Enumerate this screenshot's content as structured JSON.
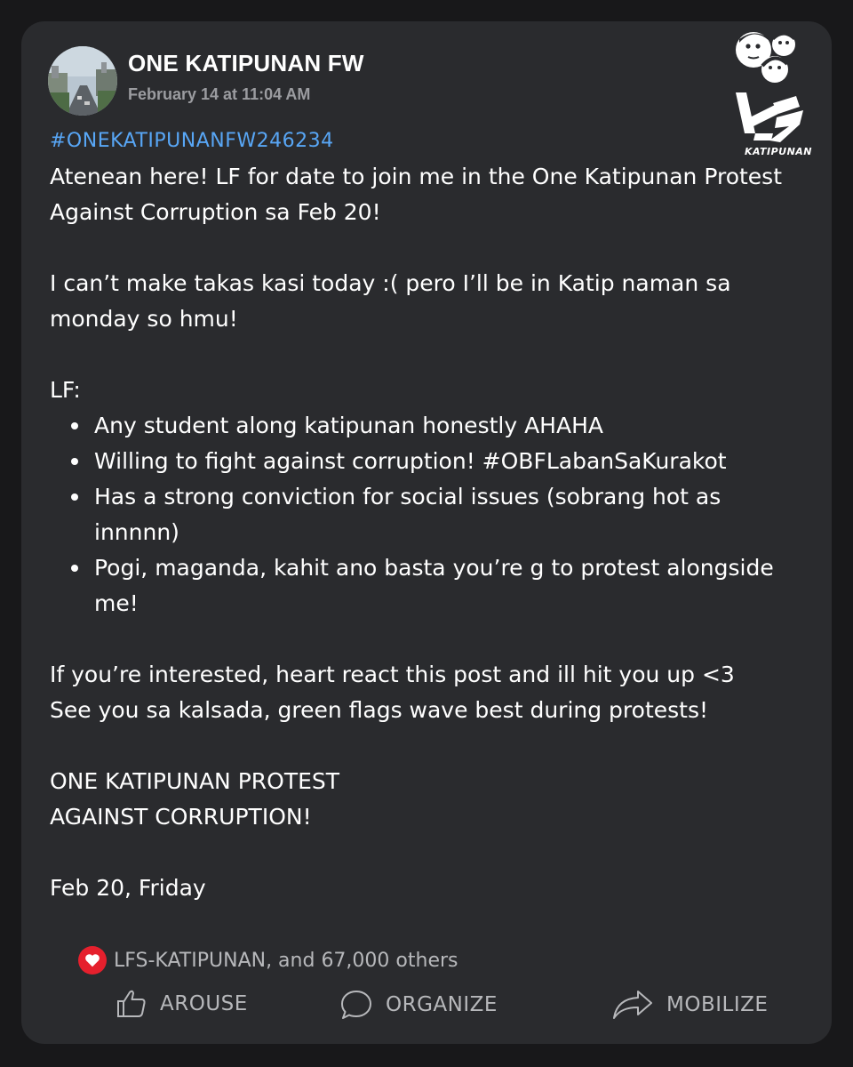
{
  "post": {
    "page_name": "ONE KATIPUNAN FW",
    "timestamp": "February 14 at 11:04 AM",
    "hashtag": "#ONEKATIPUNANFW246234",
    "paragraph1": "Atenean here! LF for date to join me in the One Katipunan Protest Against Corruption sa Feb 20!",
    "paragraph2": "I can’t make takas kasi today :( pero I’ll be in Katip naman sa monday so hmu!",
    "lf_heading": "LF:",
    "lf_items": [
      "Any student along katipunan honestly AHAHA",
      "Willing to fight against corruption! #OBFLabanSaKurakot",
      "Has a strong conviction for social issues (sobrang hot as innnnn)",
      "Pogi, maganda, kahit ano basta you’re g to protest alongside me!"
    ],
    "paragraph3_line1": "If you’re interested, heart react this post and ill hit you up <3",
    "paragraph3_line2": "See you sa kalsada, green flags wave best during protests!",
    "paragraph4_line1": "ONE KATIPUNAN PROTEST",
    "paragraph4_line2": "AGAINST CORRUPTION!",
    "paragraph5": "Feb 20, Friday"
  },
  "logo": {
    "text": "KATIPUNAN",
    "icon": "lfs-katipunan-logo"
  },
  "reactions": {
    "icon": "heart-icon",
    "text": "LFS-KATIPUNAN, and 67,000 others",
    "color": "#e5202d"
  },
  "actions": {
    "arouse": {
      "label": "AROUSE",
      "icon": "thumbs-up-icon"
    },
    "organize": {
      "label": "ORGANIZE",
      "icon": "comment-bubble-icon"
    },
    "mobilize": {
      "label": "MOBILIZE",
      "icon": "share-arrow-icon"
    }
  },
  "colors": {
    "background": "#18181a",
    "card": "#2a2b2e",
    "hashtag": "#58a6f5",
    "muted": "#9b9ca0"
  }
}
